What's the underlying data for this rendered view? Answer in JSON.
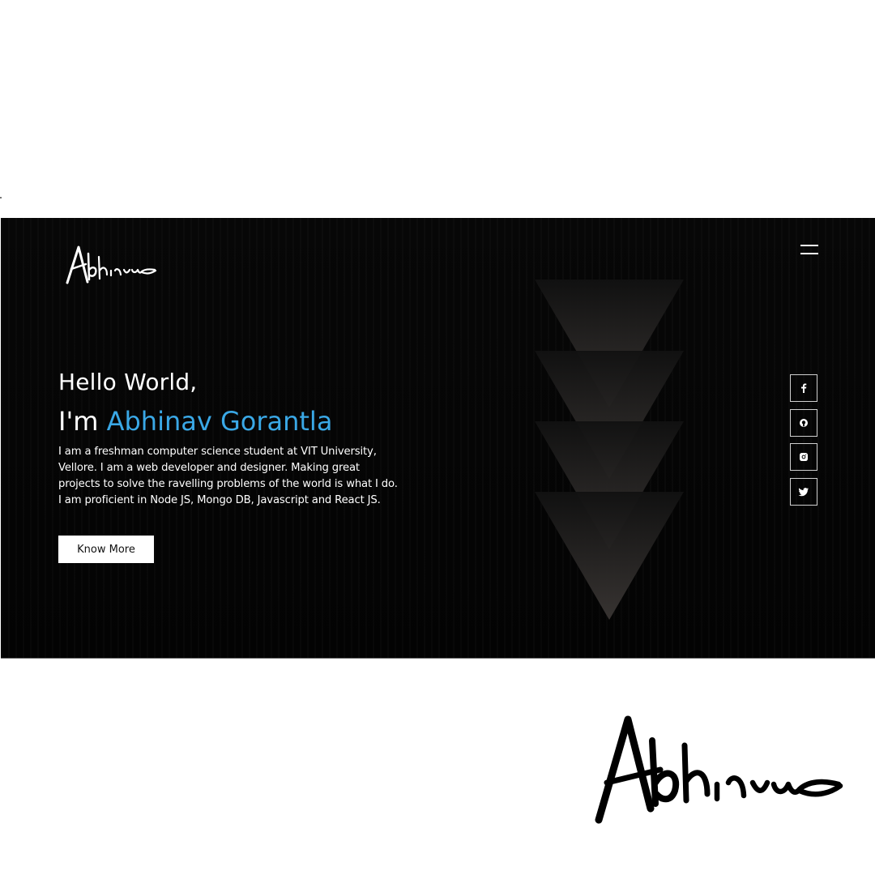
{
  "brand": {
    "logo_text": "Abhinav"
  },
  "hero": {
    "greeting": "Hello World,",
    "intro_prefix": "I'm",
    "name": "Abhinav Gorantla",
    "bio": "I am a freshman computer science student at VIT University, Vellore. I am a web developer and designer. Making great projects to solve the ravelling problems of the world is what I do. I am proficient in Node JS, Mongo DB, Javascript and React JS.",
    "cta_label": "Know More"
  },
  "social_links": [
    {
      "name": "facebook",
      "icon": "facebook-icon"
    },
    {
      "name": "github",
      "icon": "github-icon"
    },
    {
      "name": "instagram",
      "icon": "instagram-icon"
    },
    {
      "name": "twitter",
      "icon": "twitter-icon"
    }
  ],
  "theme": {
    "background": "#040404",
    "accent": "#3aa8e6",
    "text": "#ffffff",
    "page": "#ffffff"
  }
}
